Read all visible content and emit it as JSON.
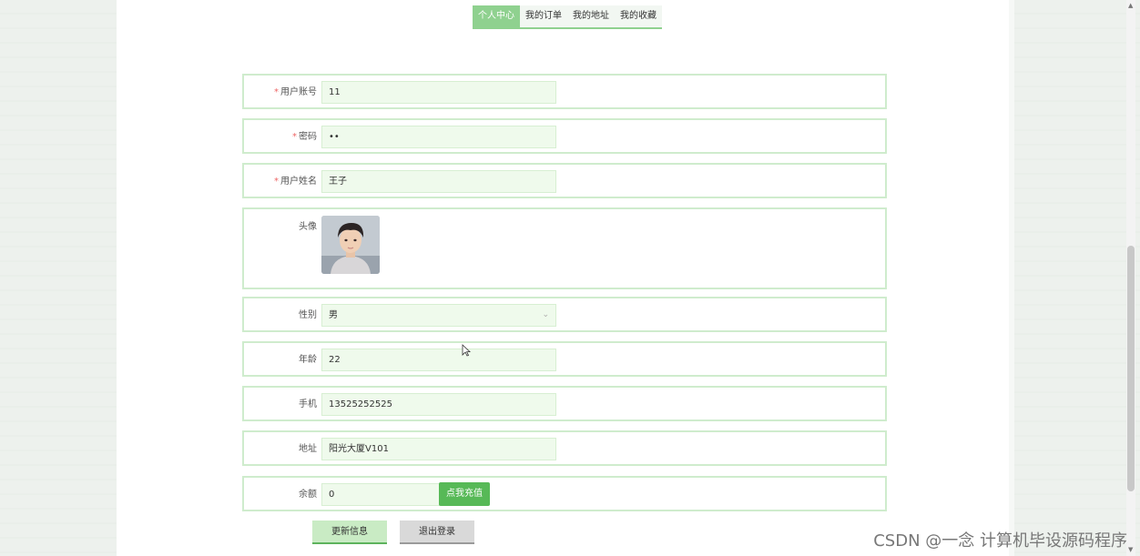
{
  "tabs": [
    {
      "label": "个人中心",
      "active": true
    },
    {
      "label": "我的订单",
      "active": false
    },
    {
      "label": "我的地址",
      "active": false
    },
    {
      "label": "我的收藏",
      "active": false
    }
  ],
  "form": {
    "account": {
      "label": "用户账号",
      "required": "*",
      "value": "11"
    },
    "password": {
      "label": "密码",
      "required": "*",
      "value": "••"
    },
    "name": {
      "label": "用户姓名",
      "required": "*",
      "value": "王子"
    },
    "avatar": {
      "label": "头像"
    },
    "gender": {
      "label": "性别",
      "value": "男"
    },
    "age": {
      "label": "年龄",
      "value": "22"
    },
    "phone": {
      "label": "手机",
      "value": "13525252525"
    },
    "address": {
      "label": "地址",
      "value": "阳光大厦V101"
    },
    "balance": {
      "label": "余额",
      "value": "0",
      "recharge_label": "点我充值"
    }
  },
  "buttons": {
    "update": "更新信息",
    "logout": "退出登录"
  },
  "watermark": "CSDN @一念 计算机毕设源码程序",
  "icons": {
    "select_arrow": "chevron-down-icon",
    "cursor": "mouse-cursor-icon"
  },
  "colors": {
    "accent": "#8fd18f",
    "field_bg": "#effaec",
    "recharge": "#57b957"
  }
}
